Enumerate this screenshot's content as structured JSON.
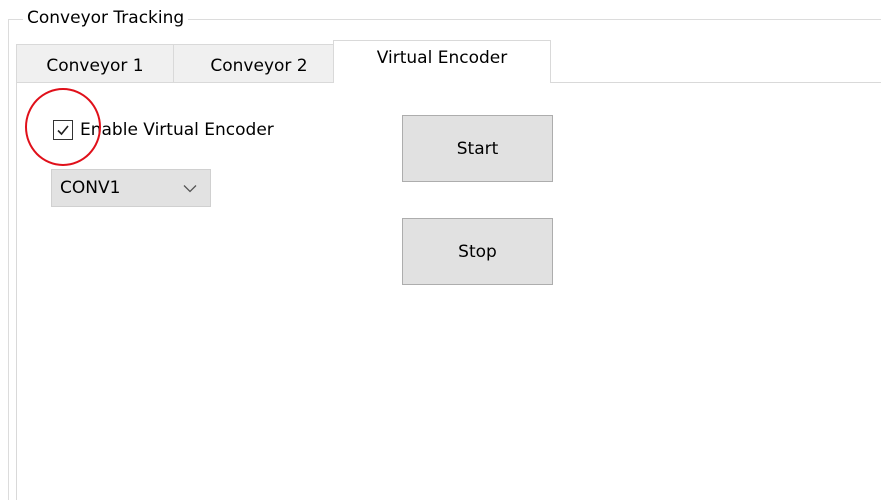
{
  "groupbox": {
    "title": "Conveyor Tracking"
  },
  "tabs": [
    {
      "label": "Conveyor 1",
      "active": false
    },
    {
      "label": "Conveyor 2",
      "active": false
    },
    {
      "label": "Virtual Encoder",
      "active": true
    }
  ],
  "virtual_encoder": {
    "enable_checkbox": {
      "label": "Enable Virtual Encoder",
      "checked": true
    },
    "conveyor_select": {
      "value": "CONV1"
    },
    "start_button": {
      "label": "Start"
    },
    "stop_button": {
      "label": "Stop"
    }
  },
  "colors": {
    "highlight_circle": "#e0101a",
    "button_bg": "#e1e1e1",
    "select_bg": "#e2e2e2",
    "tab_inactive_bg": "#f0f0f0"
  },
  "icons": {
    "checkbox": "checkmark-icon",
    "select": "chevron-down-icon"
  }
}
